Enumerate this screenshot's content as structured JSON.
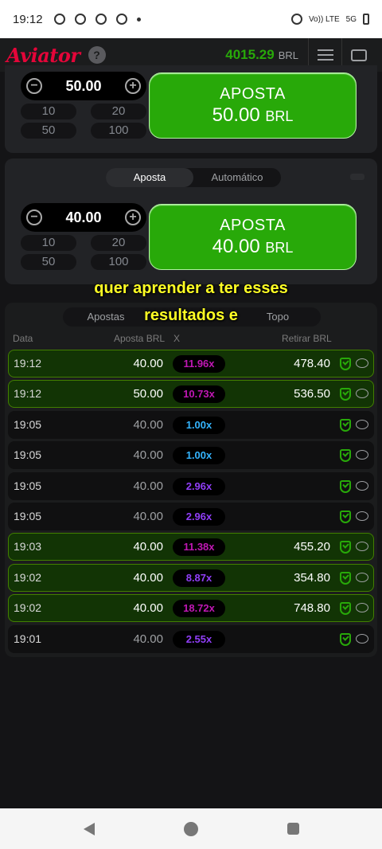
{
  "status_bar": {
    "time": "19:12",
    "network": "Vo)) LTE",
    "signal": "5G"
  },
  "header": {
    "logo": "Aviator",
    "help": "?",
    "balance": "4015.29",
    "currency": "BRL"
  },
  "bet_panel_1": {
    "amount": "50.00",
    "minus": "−",
    "plus": "+",
    "quick": [
      "10",
      "20",
      "50",
      "100"
    ],
    "button_label": "APOSTA",
    "button_amount": "50.00",
    "button_currency": "BRL"
  },
  "bet_panel_2": {
    "tabs": [
      "Aposta",
      "Automático"
    ],
    "amount": "40.00",
    "minus": "−",
    "plus": "+",
    "quick": [
      "10",
      "20",
      "50",
      "100"
    ],
    "button_label": "APOSTA",
    "button_amount": "40.00",
    "button_currency": "BRL"
  },
  "caption": {
    "line1": "quer aprender a ter esses",
    "line2": "resultados e"
  },
  "bets": {
    "tabs": [
      "Apostas",
      "",
      "Topo"
    ],
    "columns": {
      "date": "Data",
      "bet": "Aposta BRL",
      "mult": "X",
      "cashout": "Retirar BRL"
    },
    "rows": [
      {
        "time": "19:12",
        "bet": "40.00",
        "mult": "11.96x",
        "cashout": "478.40",
        "win": true,
        "color": "#c017b4"
      },
      {
        "time": "19:12",
        "bet": "50.00",
        "mult": "10.73x",
        "cashout": "536.50",
        "win": true,
        "color": "#c017b4"
      },
      {
        "time": "19:05",
        "bet": "40.00",
        "mult": "1.00x",
        "cashout": "",
        "win": false,
        "color": "#34b4ff"
      },
      {
        "time": "19:05",
        "bet": "40.00",
        "mult": "1.00x",
        "cashout": "",
        "win": false,
        "color": "#34b4ff"
      },
      {
        "time": "19:05",
        "bet": "40.00",
        "mult": "2.96x",
        "cashout": "",
        "win": false,
        "color": "#913ef8"
      },
      {
        "time": "19:05",
        "bet": "40.00",
        "mult": "2.96x",
        "cashout": "",
        "win": false,
        "color": "#913ef8"
      },
      {
        "time": "19:03",
        "bet": "40.00",
        "mult": "11.38x",
        "cashout": "455.20",
        "win": true,
        "color": "#c017b4"
      },
      {
        "time": "19:02",
        "bet": "40.00",
        "mult": "8.87x",
        "cashout": "354.80",
        "win": true,
        "color": "#913ef8"
      },
      {
        "time": "19:02",
        "bet": "40.00",
        "mult": "18.72x",
        "cashout": "748.80",
        "win": true,
        "color": "#c017b4"
      },
      {
        "time": "19:01",
        "bet": "40.00",
        "mult": "2.55x",
        "cashout": "",
        "win": false,
        "color": "#913ef8"
      }
    ]
  },
  "colors": {
    "accent_green": "#28a909",
    "brand_red": "#e50539",
    "caption_yellow": "#ffff24"
  }
}
